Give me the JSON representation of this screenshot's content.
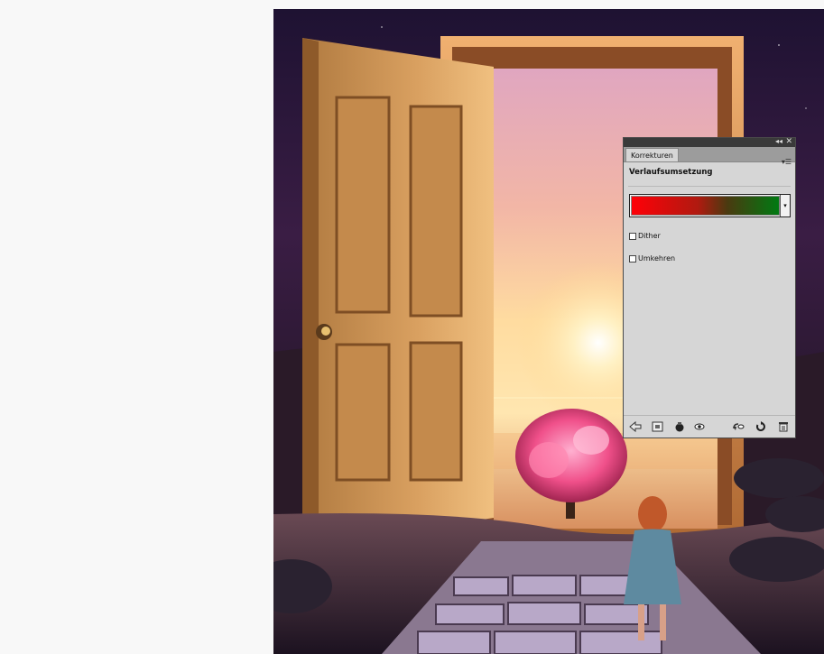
{
  "panel": {
    "collapse_glyph": "◂◂",
    "close_glyph": "✕",
    "tab_label": "Korrekturen",
    "menu_glyph": "▾☰",
    "adjustment_title": "Verlaufsumsetzung",
    "gradient": {
      "start_color": "#ff0008",
      "end_color": "#007a12",
      "dropdown_glyph": "▾"
    },
    "options": [
      {
        "label": "Dither",
        "checked": false
      },
      {
        "label": "Umkehren",
        "checked": false
      }
    ],
    "bottom_icons": [
      "back-arrow-icon",
      "expanded-view-icon",
      "clip-to-layer-icon",
      "visibility-eye-icon",
      "view-previous-state-icon",
      "reset-icon",
      "trash-icon"
    ]
  },
  "colors": {
    "page_background": "#f8f8f8",
    "panel_background": "#d6d6d6",
    "panel_title_strip": "#3a3a3a",
    "door_wood": "#d9a060",
    "sunset_glow": "#ffd890",
    "tree_blossom": "#f0508a"
  }
}
